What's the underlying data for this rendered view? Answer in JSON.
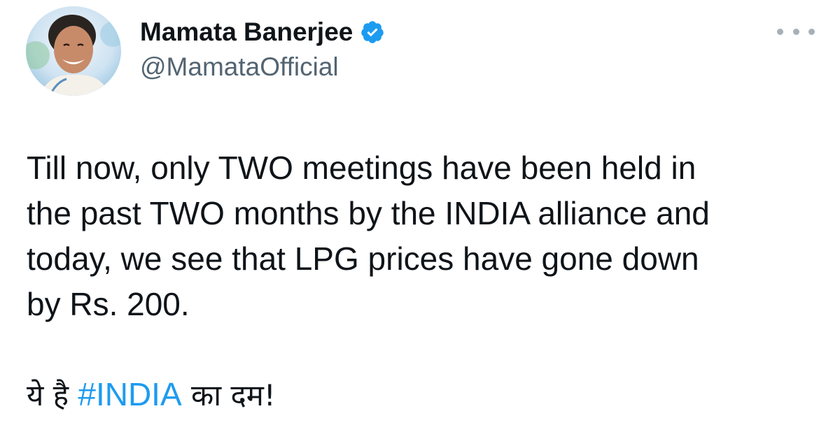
{
  "author": {
    "display_name": "Mamata Banerjee",
    "handle": "@MamataOfficial",
    "verified": true,
    "verified_color": "#1d9bf0"
  },
  "menu": {
    "icon": "more-horizontal-icon"
  },
  "tweet": {
    "lines": [
      "Till now, only TWO meetings have been held in",
      "the past TWO months by the INDIA alliance and",
      "today, we see that LPG prices have gone down",
      "by Rs. 200."
    ],
    "tagline_prefix": "ये है ",
    "hashtag": "#INDIA",
    "tagline_suffix": " का दम!"
  },
  "colors": {
    "text": "#0f1419",
    "secondary": "#536471",
    "link": "#1d9bf0"
  }
}
